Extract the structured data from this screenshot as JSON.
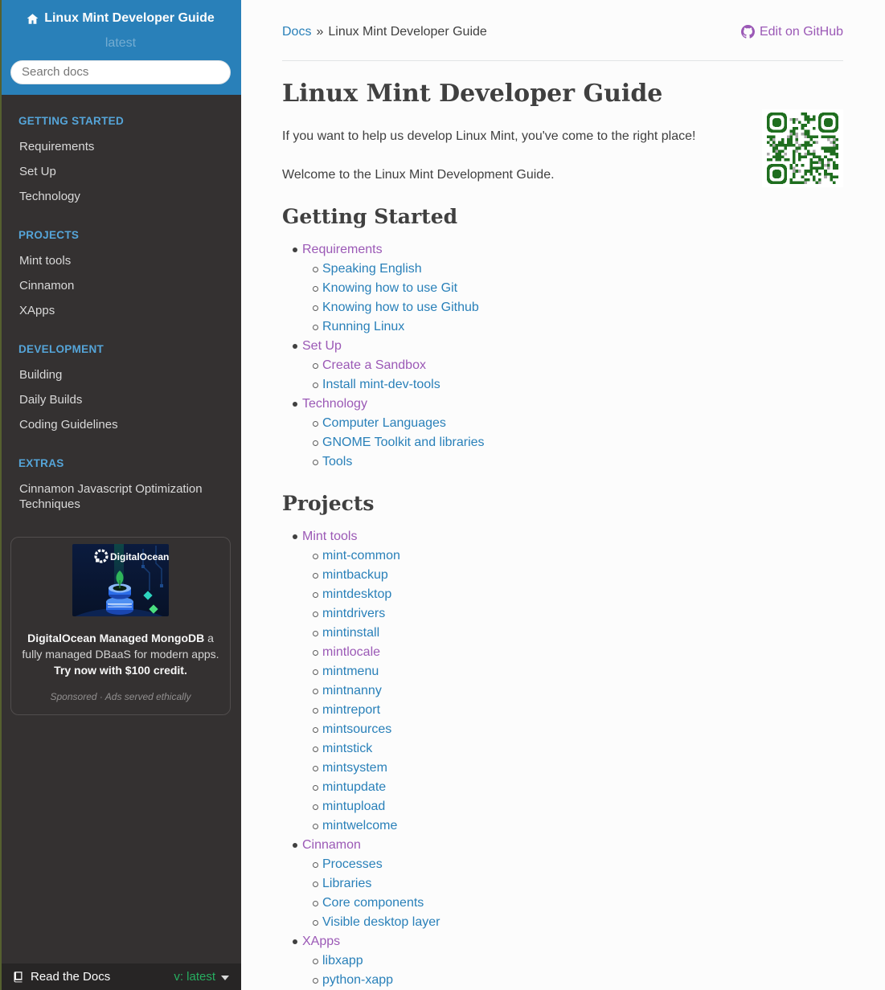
{
  "colors": {
    "header_blue": "#2980b9",
    "sidebar_bg": "#343131",
    "footer_bg": "#272525",
    "caption_blue": "#55a5d9",
    "link_blue": "#2980b9",
    "link_visited_purple": "#9b59b6",
    "version_green": "#27ae60",
    "body_text": "#404040",
    "qr_green": "#1f6e1f"
  },
  "icons": [
    "home-icon",
    "github-icon",
    "book-icon",
    "caret-down-icon",
    "qr-code-image",
    "digitalocean-logo"
  ],
  "sidebar": {
    "title": "Linux Mint Developer Guide",
    "version": "latest",
    "search_placeholder": "Search docs",
    "sections": [
      {
        "caption": "GETTING STARTED",
        "items": [
          "Requirements",
          "Set Up",
          "Technology"
        ]
      },
      {
        "caption": "PROJECTS",
        "items": [
          "Mint tools",
          "Cinnamon",
          "XApps"
        ]
      },
      {
        "caption": "DEVELOPMENT",
        "items": [
          "Building",
          "Daily Builds",
          "Coding Guidelines"
        ]
      },
      {
        "caption": "EXTRAS",
        "items": [
          "Cinnamon Javascript Optimization Techniques"
        ]
      }
    ],
    "ad": {
      "logo_text": "DigitalOcean",
      "headline_bold": "DigitalOcean Managed MongoDB",
      "headline_rest": " a fully managed DBaaS for modern apps. ",
      "cta": "Try now with $100 credit.",
      "note": "Sponsored · Ads served ethically"
    },
    "footer": {
      "label": "Read the Docs",
      "version": "v: latest"
    }
  },
  "breadcrumb": {
    "root": "Docs",
    "separator": "»",
    "current": "Linux Mint Developer Guide"
  },
  "edit_on_github": "Edit on GitHub",
  "page": {
    "title": "Linux Mint Developer Guide",
    "paragraphs": [
      "If you want to help us develop Linux Mint, you've come to the right place!",
      "Welcome to the Linux Mint Development Guide."
    ],
    "sections": [
      {
        "heading": "Getting Started",
        "items": [
          {
            "label": "Requirements",
            "visited": true,
            "children": [
              {
                "label": "Speaking English"
              },
              {
                "label": "Knowing how to use Git"
              },
              {
                "label": "Knowing how to use Github"
              },
              {
                "label": "Running Linux"
              }
            ]
          },
          {
            "label": "Set Up",
            "visited": true,
            "children": [
              {
                "label": "Create a Sandbox",
                "visited": true
              },
              {
                "label": "Install mint-dev-tools"
              }
            ]
          },
          {
            "label": "Technology",
            "visited": true,
            "children": [
              {
                "label": "Computer Languages"
              },
              {
                "label": "GNOME Toolkit and libraries"
              },
              {
                "label": "Tools"
              }
            ]
          }
        ]
      },
      {
        "heading": "Projects",
        "items": [
          {
            "label": "Mint tools",
            "visited": true,
            "children": [
              {
                "label": "mint-common"
              },
              {
                "label": "mintbackup"
              },
              {
                "label": "mintdesktop"
              },
              {
                "label": "mintdrivers"
              },
              {
                "label": "mintinstall"
              },
              {
                "label": "mintlocale",
                "visited": true
              },
              {
                "label": "mintmenu"
              },
              {
                "label": "mintnanny"
              },
              {
                "label": "mintreport"
              },
              {
                "label": "mintsources"
              },
              {
                "label": "mintstick"
              },
              {
                "label": "mintsystem"
              },
              {
                "label": "mintupdate"
              },
              {
                "label": "mintupload"
              },
              {
                "label": "mintwelcome"
              }
            ]
          },
          {
            "label": "Cinnamon",
            "visited": true,
            "children": [
              {
                "label": "Processes"
              },
              {
                "label": "Libraries"
              },
              {
                "label": "Core components"
              },
              {
                "label": "Visible desktop layer"
              }
            ]
          },
          {
            "label": "XApps",
            "visited": true,
            "children": [
              {
                "label": "libxapp"
              },
              {
                "label": "python-xapp"
              }
            ]
          }
        ]
      }
    ]
  }
}
